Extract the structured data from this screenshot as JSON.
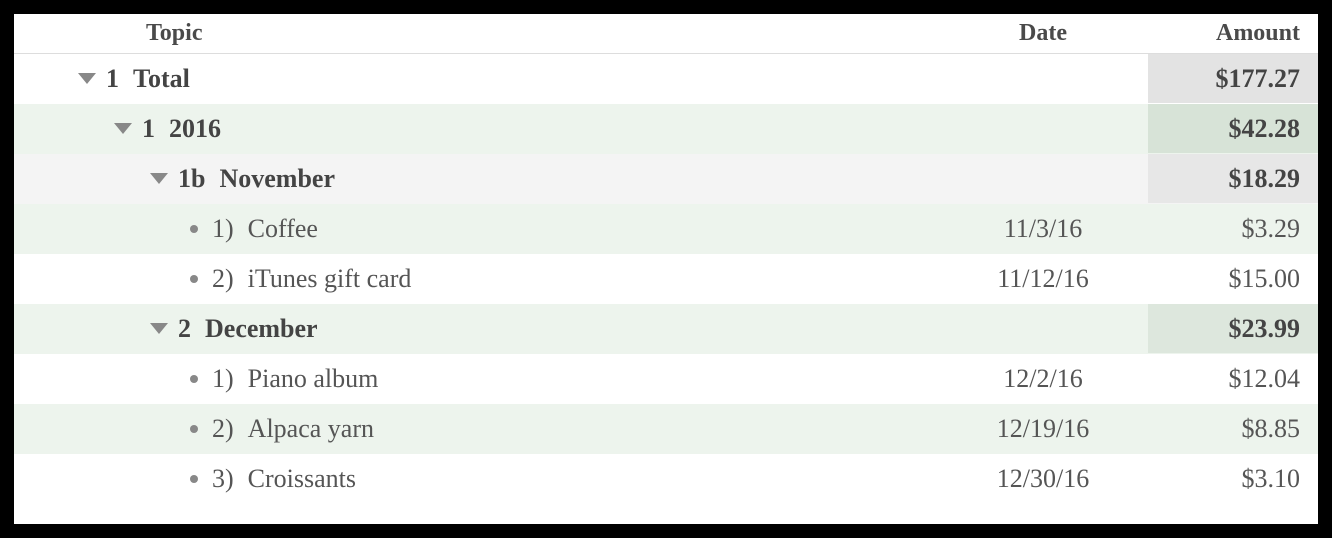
{
  "columns": {
    "topic": "Topic",
    "date": "Date",
    "amount": "Amount"
  },
  "total": {
    "num": "1",
    "label": "Total",
    "amount": "$177.27"
  },
  "year": {
    "num": "1",
    "label": "2016",
    "amount": "$42.28"
  },
  "months": [
    {
      "num": "1b",
      "label": "November",
      "amount": "$18.29",
      "items": [
        {
          "num": "1)",
          "label": "Coffee",
          "date": "11/3/16",
          "amount": "$3.29"
        },
        {
          "num": "2)",
          "label": "iTunes gift card",
          "date": "11/12/16",
          "amount": "$15.00"
        }
      ]
    },
    {
      "num": "2",
      "label": "December",
      "amount": "$23.99",
      "items": [
        {
          "num": "1)",
          "label": "Piano album",
          "date": "12/2/16",
          "amount": "$12.04"
        },
        {
          "num": "2)",
          "label": "Alpaca yarn",
          "date": "12/19/16",
          "amount": "$8.85"
        },
        {
          "num": "3)",
          "label": "Croissants",
          "date": "12/30/16",
          "amount": "$3.10"
        }
      ]
    }
  ]
}
